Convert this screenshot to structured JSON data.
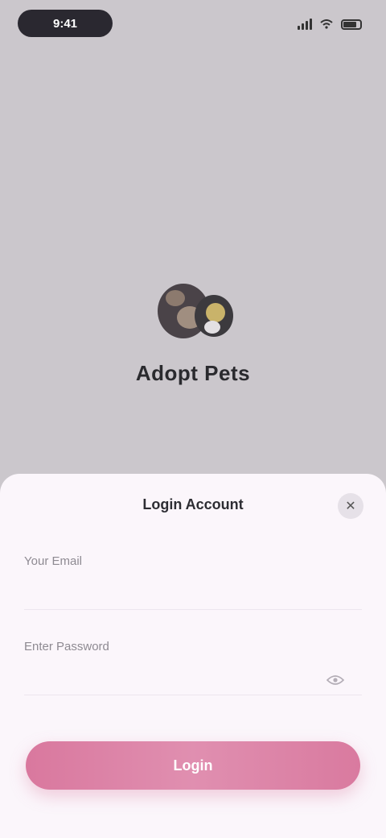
{
  "status_bar": {
    "time": "9:41",
    "icons": [
      "signal-icon",
      "wifi-icon",
      "battery-icon"
    ]
  },
  "hero": {
    "logo_icon": "app-logo-icon",
    "title": "Adopt Pets"
  },
  "sheet": {
    "title": "Login Account",
    "close_icon": "close-icon",
    "close_glyph": "✕",
    "email_label": "Your Email",
    "email_placeholder": "",
    "password_label": "Enter Password",
    "password_placeholder": "",
    "eye_icon": "eye-icon",
    "submit_label": "Login"
  },
  "colors": {
    "background": "#cbc7cc",
    "sheet": "#fbf6fb",
    "accent": "#d9789e"
  }
}
